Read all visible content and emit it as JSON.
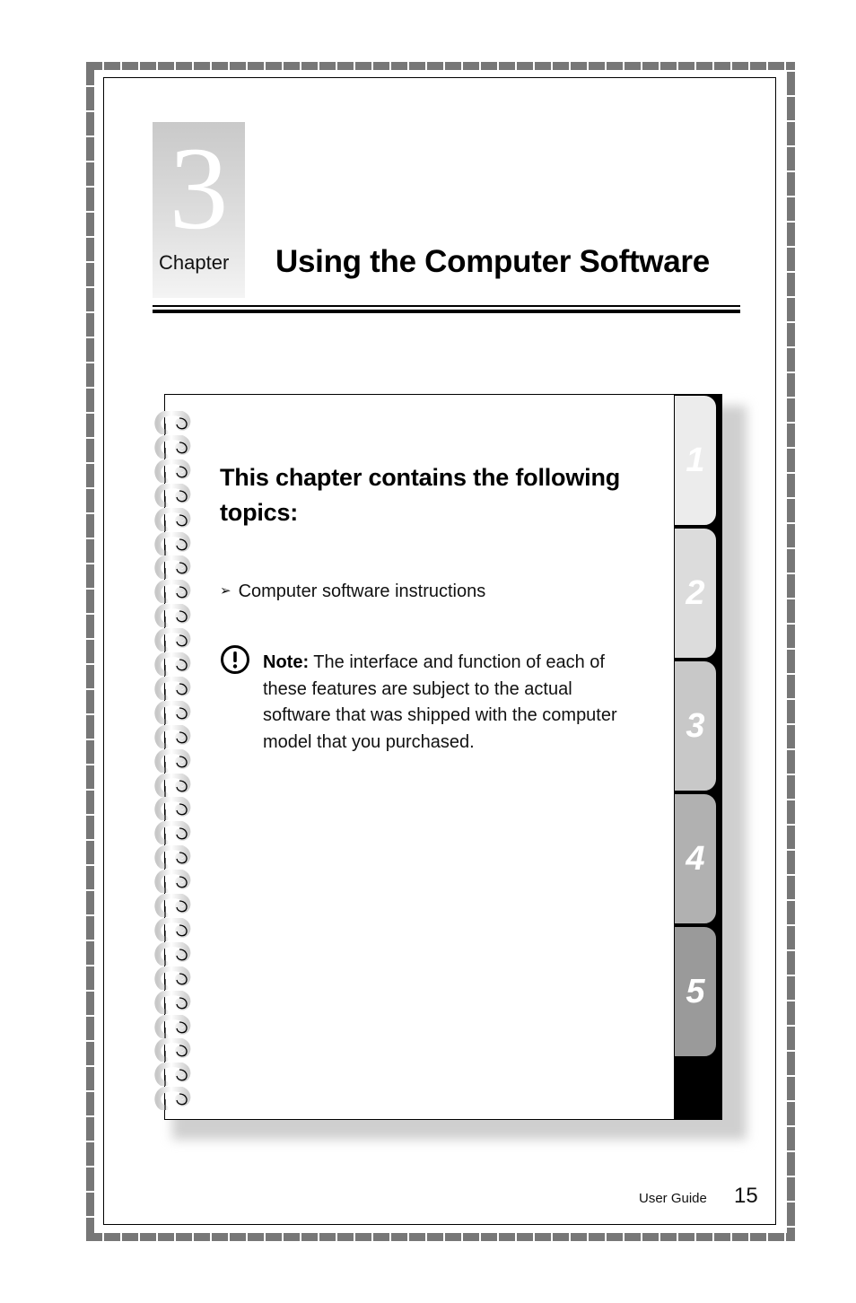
{
  "chapter": {
    "number": "3",
    "label": "Chapter",
    "title": "Using the Computer Software"
  },
  "contents": {
    "heading": "This chapter contains the following topics:",
    "topics": [
      {
        "bullet": "➢",
        "label": "Computer software instructions"
      }
    ],
    "note": {
      "icon": "exclamation-circle-icon",
      "label": "Note:",
      "text": " The interface and function of each of these features are subject to the actual software that was shipped with the computer model that you purchased."
    }
  },
  "tabs": [
    {
      "label": "1",
      "color": "#ececec"
    },
    {
      "label": "2",
      "color": "#dcdcdc"
    },
    {
      "label": "3",
      "color": "#c8c8c8"
    },
    {
      "label": "4",
      "color": "#b1b1b1"
    },
    {
      "label": "5",
      "color": "#9a9a9a"
    }
  ],
  "footer": {
    "label": "User Guide",
    "page_number": "15"
  }
}
